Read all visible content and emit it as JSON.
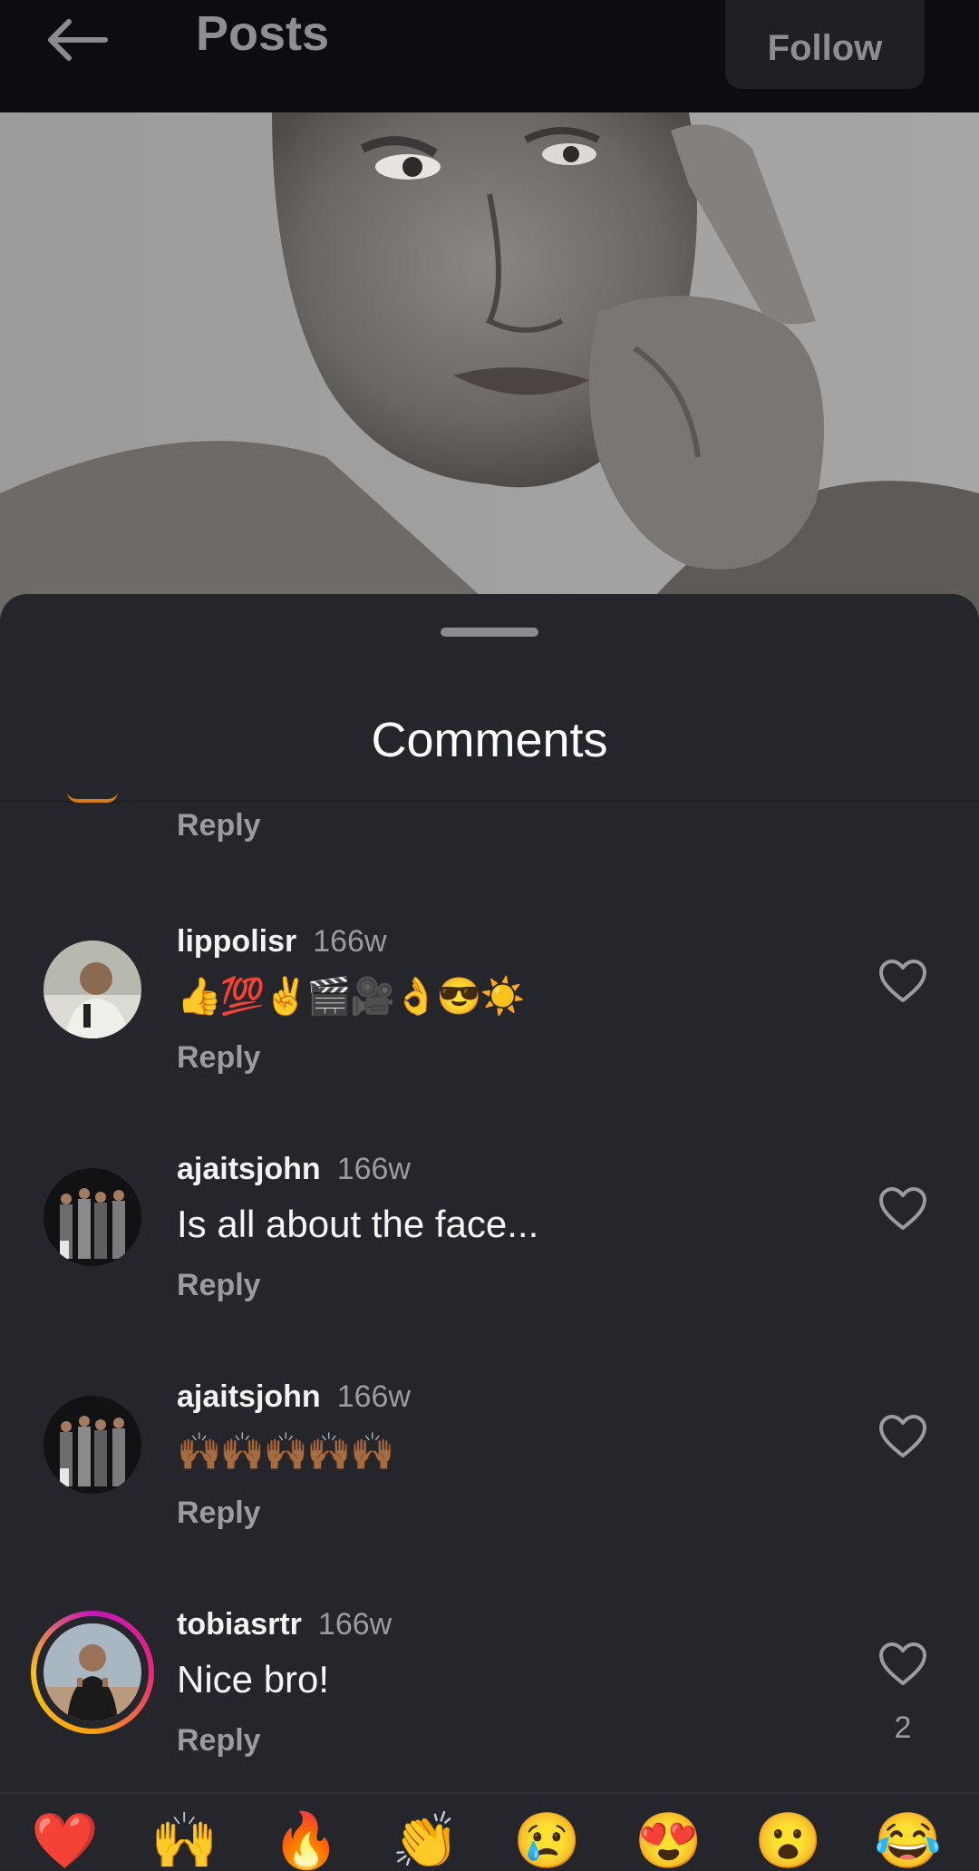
{
  "header": {
    "title": "Posts",
    "follow_label": "Follow"
  },
  "sheet": {
    "title": "Comments",
    "prev_reply_label": "Reply"
  },
  "comments": [
    {
      "username": "lippolisr",
      "time": "166w",
      "text": "👍💯✌️🎬🎥👌😎☀️",
      "reply_label": "Reply",
      "likes": ""
    },
    {
      "username": "ajaitsjohn",
      "time": "166w",
      "text": "Is all about the face...",
      "reply_label": "Reply",
      "likes": ""
    },
    {
      "username": "ajaitsjohn",
      "time": "166w",
      "text": "🙌🏾🙌🏾🙌🏾🙌🏾🙌🏾",
      "reply_label": "Reply",
      "likes": ""
    },
    {
      "username": "tobiasrtr",
      "time": "166w",
      "text": "Nice bro!",
      "reply_label": "Reply",
      "likes": "2"
    }
  ],
  "quick_reactions": [
    "❤️",
    "🙌",
    "🔥",
    "👏",
    "😢",
    "😍",
    "😮",
    "😂"
  ],
  "icons": {
    "back": "back-arrow-icon",
    "heart": "heart-outline-icon"
  },
  "colors": {
    "background": "#24262b",
    "topbar": "#0c0d10",
    "muted_text": "#9a9ca0",
    "story_ring_start": "#c216b8",
    "story_ring_end": "#f6a20f"
  }
}
